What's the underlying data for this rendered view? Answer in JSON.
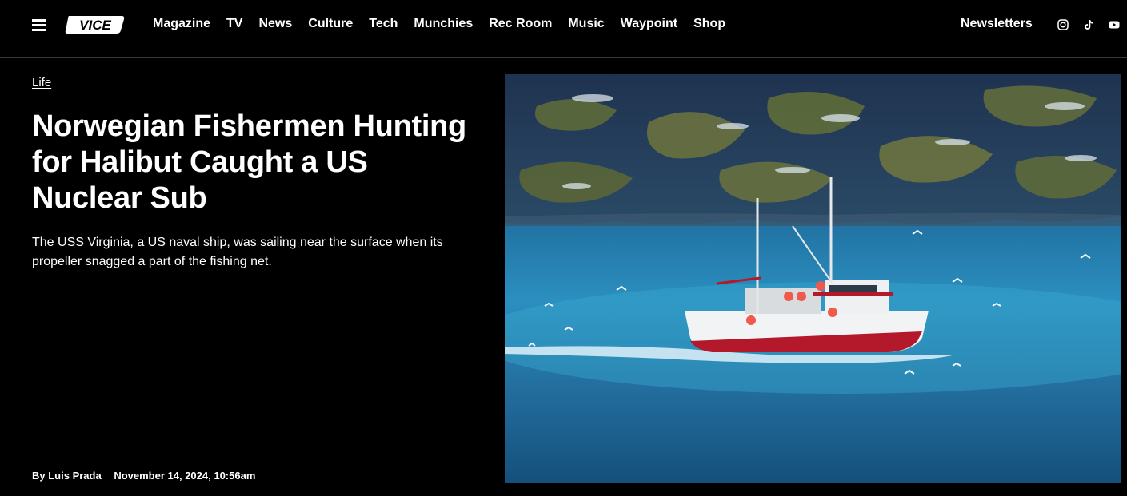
{
  "header": {
    "nav": [
      "Magazine",
      "TV",
      "News",
      "Culture",
      "Tech",
      "Munchies",
      "Rec Room",
      "Music",
      "Waypoint",
      "Shop"
    ],
    "newsletters_label": "Newsletters",
    "logo_text": "VICE",
    "social_icons": [
      "instagram-icon",
      "tiktok-icon",
      "youtube-icon"
    ]
  },
  "article": {
    "category": "Life",
    "headline": "Norwegian Fishermen Hunting for Halibut Caught a US Nuclear Sub",
    "dek": "The USS Virginia, a US naval ship, was sailing near the surface when its propeller snagged a part of the fishing net.",
    "byline": "By Luis Prada",
    "date": "November 14, 2024, 10:56am"
  },
  "colors": {
    "background": "#000000",
    "text": "#ffffff",
    "divider": "#3a3a3a"
  }
}
